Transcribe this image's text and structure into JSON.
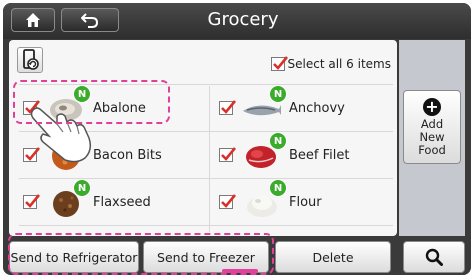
{
  "header": {
    "title": "Grocery"
  },
  "list": {
    "select_all_label": "Select all 6 items",
    "select_all_checked": true,
    "items": [
      {
        "name": "Abalone",
        "checked": true,
        "new_badge": "N"
      },
      {
        "name": "Anchovy",
        "checked": true,
        "new_badge": "N"
      },
      {
        "name": "Bacon Bits",
        "checked": true,
        "new_badge": ""
      },
      {
        "name": "Beef Filet",
        "checked": true,
        "new_badge": "N"
      },
      {
        "name": "Flaxseed",
        "checked": true,
        "new_badge": "N"
      },
      {
        "name": "Flour",
        "checked": true,
        "new_badge": "N"
      }
    ]
  },
  "side": {
    "add_food_line1": "Add",
    "add_food_line2": "New Food",
    "add_icon_glyph": "+"
  },
  "bottom": {
    "send_refrigerator": "Send to Refrigerator",
    "send_freezer": "Send to Freezer",
    "delete": "Delete"
  },
  "icons": [
    "home-icon",
    "back-icon",
    "sync-device-icon",
    "checkmark-icon",
    "plus-circle-icon",
    "search-icon",
    "hand-pointer-icon"
  ],
  "colors": {
    "accent_check": "#d9302b",
    "new_badge": "#3aab2a",
    "highlight_dash": "#e0409a"
  }
}
